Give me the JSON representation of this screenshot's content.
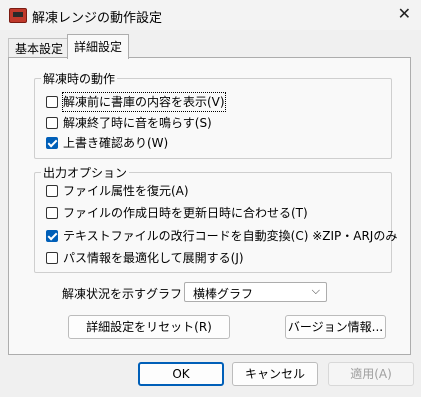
{
  "window": {
    "title": "解凍レンジの動作設定",
    "close_glyph": "✕"
  },
  "tabs": [
    {
      "label": "基本設定",
      "active": false
    },
    {
      "label": "詳細設定",
      "active": true
    }
  ],
  "group_extract": {
    "legend": "解凍時の動作",
    "items": [
      {
        "label": "解凍前に書庫の内容を表示(V)",
        "checked": false
      },
      {
        "label": "解凍終了時に音を鳴らす(S)",
        "checked": false
      },
      {
        "label": "上書き確認あり(W)",
        "checked": true
      }
    ]
  },
  "group_output": {
    "legend": "出力オプション",
    "items": [
      {
        "label": "ファイル属性を復元(A)",
        "checked": false
      },
      {
        "label": "ファイルの作成日時を更新日時に合わせる(T)",
        "checked": false
      },
      {
        "label": "テキストファイルの改行コードを自動変換(C) ※ZIP・ARJのみ",
        "checked": true
      },
      {
        "label": "パス情報を最適化して展開する(J)",
        "checked": false
      }
    ]
  },
  "progress_graph": {
    "label": "解凍状況を示すグラフ：",
    "selected": "横棒グラフ"
  },
  "buttons": {
    "reset": "詳細設定をリセット(R)",
    "version": "バージョン情報...",
    "ok": "OK",
    "cancel": "キャンセル",
    "apply": "適用(A)"
  }
}
